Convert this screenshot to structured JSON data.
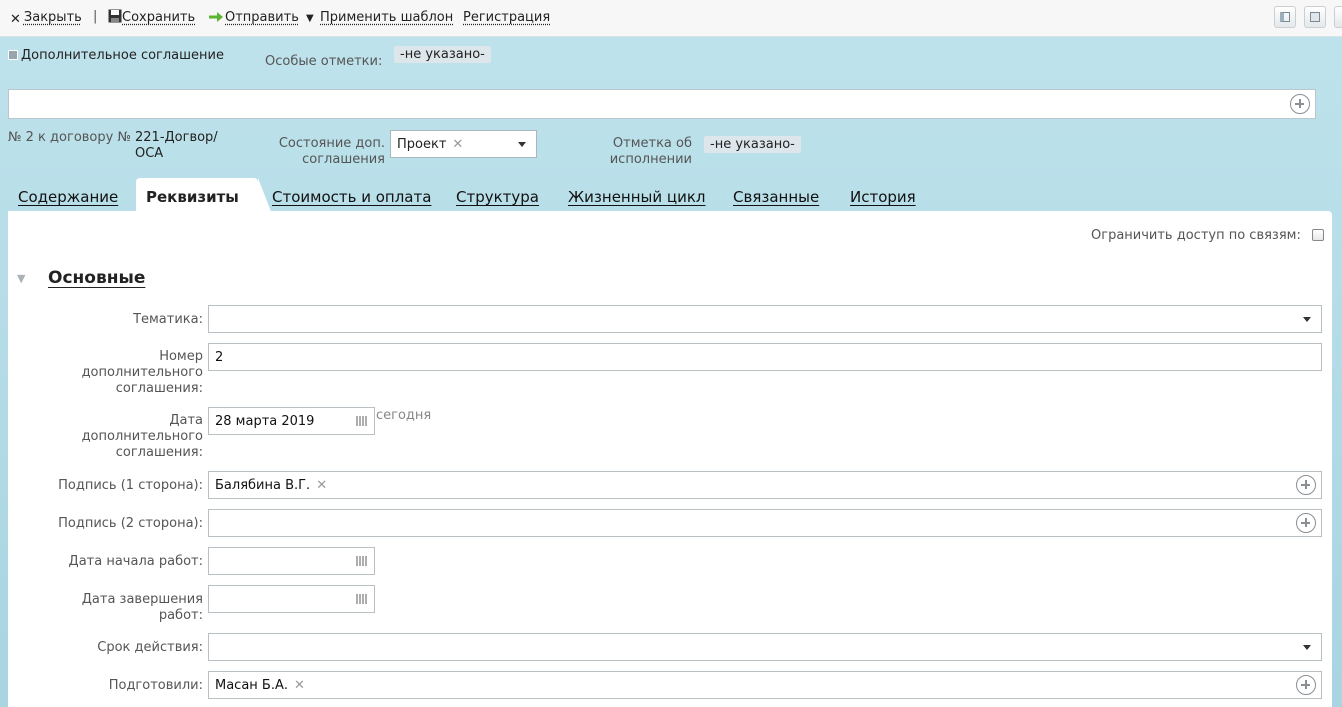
{
  "toolbar": {
    "close_label": "Закрыть",
    "save_label": "Сохранить",
    "send_label": "Отправить",
    "apply_template_label": "Применить шаблон",
    "registration_label": "Регистрация",
    "separator": "|"
  },
  "header": {
    "doc_type": "Дополнительное соглашение",
    "special_marks_label": "Особые отметки:",
    "special_marks_value": "-не указано-",
    "number_prefix": "№ 2 к договору №",
    "contract_number": "221-Догвор/ ОСА",
    "state_label": "Состояние доп. соглашения",
    "state_value": "Проект",
    "execution_label": "Отметка об исполнении",
    "execution_value": "-не указано-"
  },
  "tabs": [
    {
      "label": "Содержание"
    },
    {
      "label": "Реквизиты",
      "active": true
    },
    {
      "label": "Стоимость и оплата"
    },
    {
      "label": "Структура"
    },
    {
      "label": "Жизненный цикл"
    },
    {
      "label": "Связанные"
    },
    {
      "label": "История"
    }
  ],
  "panel": {
    "restrict_label": "Ограничить доступ по связям:",
    "restrict_checked": false,
    "section_title": "Основные",
    "fields": {
      "topic_label": "Тематика:",
      "topic_value": "",
      "number_label": "Номер дополнительного соглашения:",
      "number_value": "2",
      "date_label": "Дата дополнительного соглашения:",
      "date_value": "28 марта 2019",
      "today_link": "сегодня",
      "sign1_label": "Подпись (1 сторона):",
      "sign1_value": "Балябина В.Г.",
      "sign2_label": "Подпись (2 сторона):",
      "sign2_value": "",
      "start_label": "Дата начала работ:",
      "start_value": "",
      "end_label": "Дата завершения работ:",
      "end_value": "",
      "term_label": "Срок действия:",
      "term_value": "",
      "prepared_label": "Подготовили:",
      "prepared_value": "Масан Б.А."
    }
  },
  "icons": {
    "close": "close-icon",
    "save": "floppy-icon",
    "send": "arrow-right-icon",
    "add": "plus-circle-icon",
    "calendar": "calendar-icon",
    "collapse": "triangle-down-icon"
  }
}
